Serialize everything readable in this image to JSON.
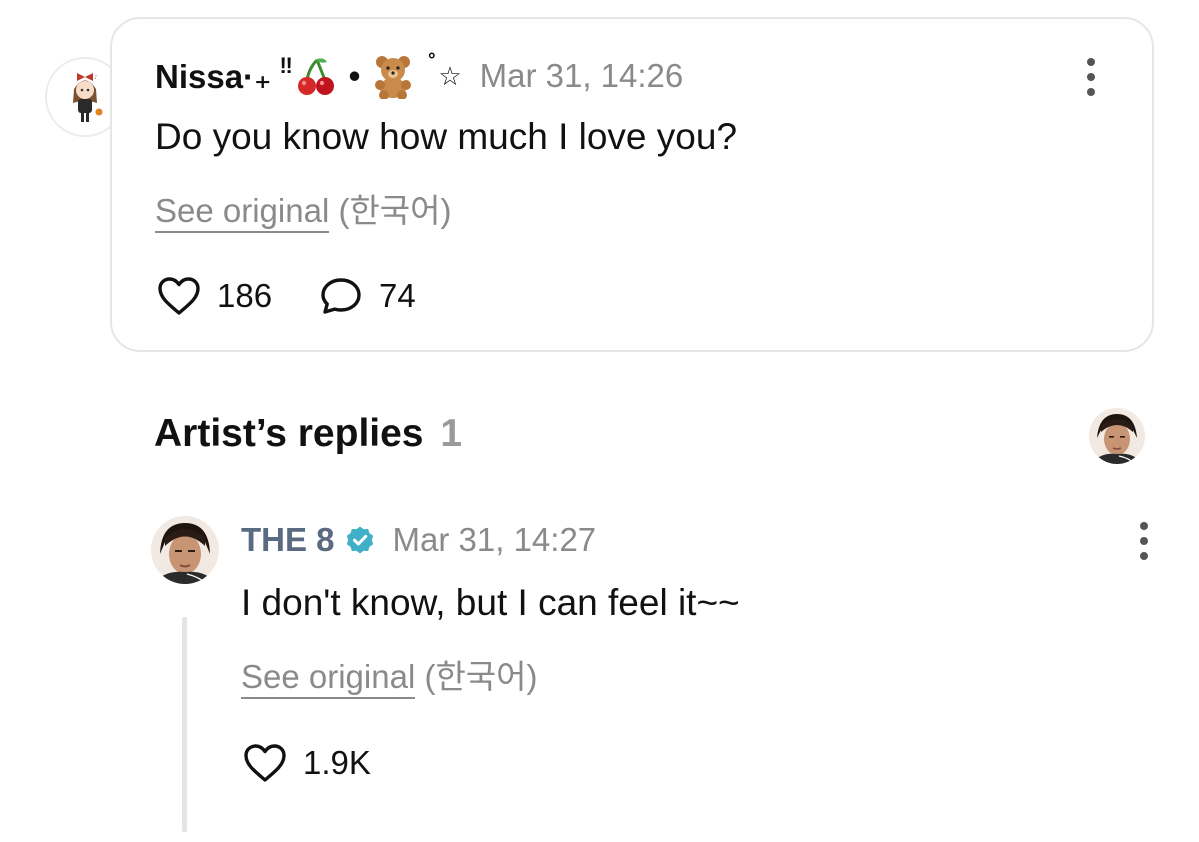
{
  "post": {
    "author": "Nissa·₊",
    "author_suffix_1": "‼",
    "author_suffix_2": "•",
    "author_suffix_3": "˚",
    "author_suffix_4": "☆",
    "timestamp": "Mar 31, 14:26",
    "body": "Do you know how much I love you?",
    "see_original_label": "See original",
    "original_language": "(한국어)",
    "likes": "186",
    "comments": "74"
  },
  "artist_replies": {
    "heading": "Artist’s replies",
    "count": "1"
  },
  "reply": {
    "author": "THE 8",
    "timestamp": "Mar 31, 14:27",
    "body": "I don't know, but I can feel it~~",
    "see_original_label": "See original",
    "original_language": "(한국어)",
    "likes": "1.9K"
  },
  "colors": {
    "verified_badge": "#3fb0c8",
    "artist_name": "#5a6a80",
    "muted_text": "#8a8a8a",
    "card_border": "#e6e6e6"
  },
  "icons": {
    "post_author_emoji_1": "cherry-icon",
    "post_author_emoji_2": "teddy-bear-icon",
    "like": "heart-icon",
    "comment": "comment-bubble-icon",
    "more": "more-vertical-icon",
    "verified": "verified-badge-icon"
  }
}
